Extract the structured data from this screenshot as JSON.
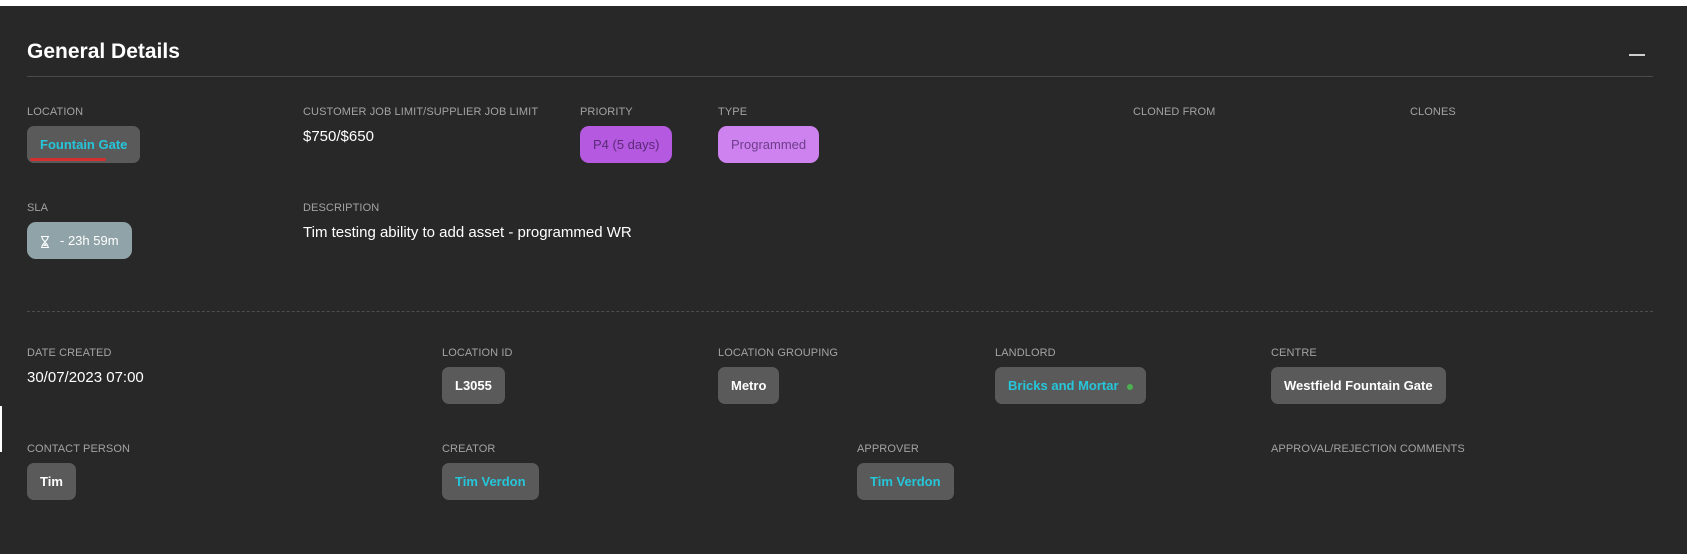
{
  "section": {
    "title": "General Details",
    "collapse_icon": "minus-icon"
  },
  "row1": {
    "location": {
      "label": "LOCATION",
      "value": "Fountain Gate"
    },
    "job_limit": {
      "label": "CUSTOMER JOB LIMIT/SUPPLIER JOB LIMIT",
      "value": "$750/$650"
    },
    "priority": {
      "label": "PRIORITY",
      "value": "P4 (5 days)"
    },
    "type": {
      "label": "TYPE",
      "value": "Programmed"
    },
    "cloned_from": {
      "label": "CLONED FROM"
    },
    "clones": {
      "label": "CLONES"
    }
  },
  "row2": {
    "sla": {
      "label": "SLA",
      "value": "- 23h 59m",
      "icon": "hourglass-icon"
    },
    "description": {
      "label": "DESCRIPTION",
      "value": "Tim testing ability to add asset - programmed WR"
    }
  },
  "row3": {
    "date_created": {
      "label": "DATE CREATED",
      "value": "30/07/2023 07:00"
    },
    "location_id": {
      "label": "LOCATION ID",
      "value": "L3055"
    },
    "location_grouping": {
      "label": "LOCATION GROUPING",
      "value": "Metro"
    },
    "landlord": {
      "label": "LANDLORD",
      "value": "Bricks and Mortar"
    },
    "centre": {
      "label": "CENTRE",
      "value": "Westfield Fountain Gate"
    }
  },
  "row4": {
    "contact_person": {
      "label": "CONTACT PERSON",
      "value": "Tim"
    },
    "creator": {
      "label": "CREATOR",
      "value": "Tim Verdon"
    },
    "approver": {
      "label": "APPROVER",
      "value": "Tim Verdon"
    },
    "approval_comments": {
      "label": "APPROVAL/REJECTION COMMENTS"
    }
  },
  "colors": {
    "panel_bg": "#282828",
    "chip_bg": "#5a5a5a",
    "link": "#26c6da",
    "priority_chip": "#b559e0",
    "type_chip": "#cd82f0",
    "sla_chip": "#8fa3a8",
    "underline_red": "#d32f2f",
    "status_dot": "#4caf50"
  }
}
